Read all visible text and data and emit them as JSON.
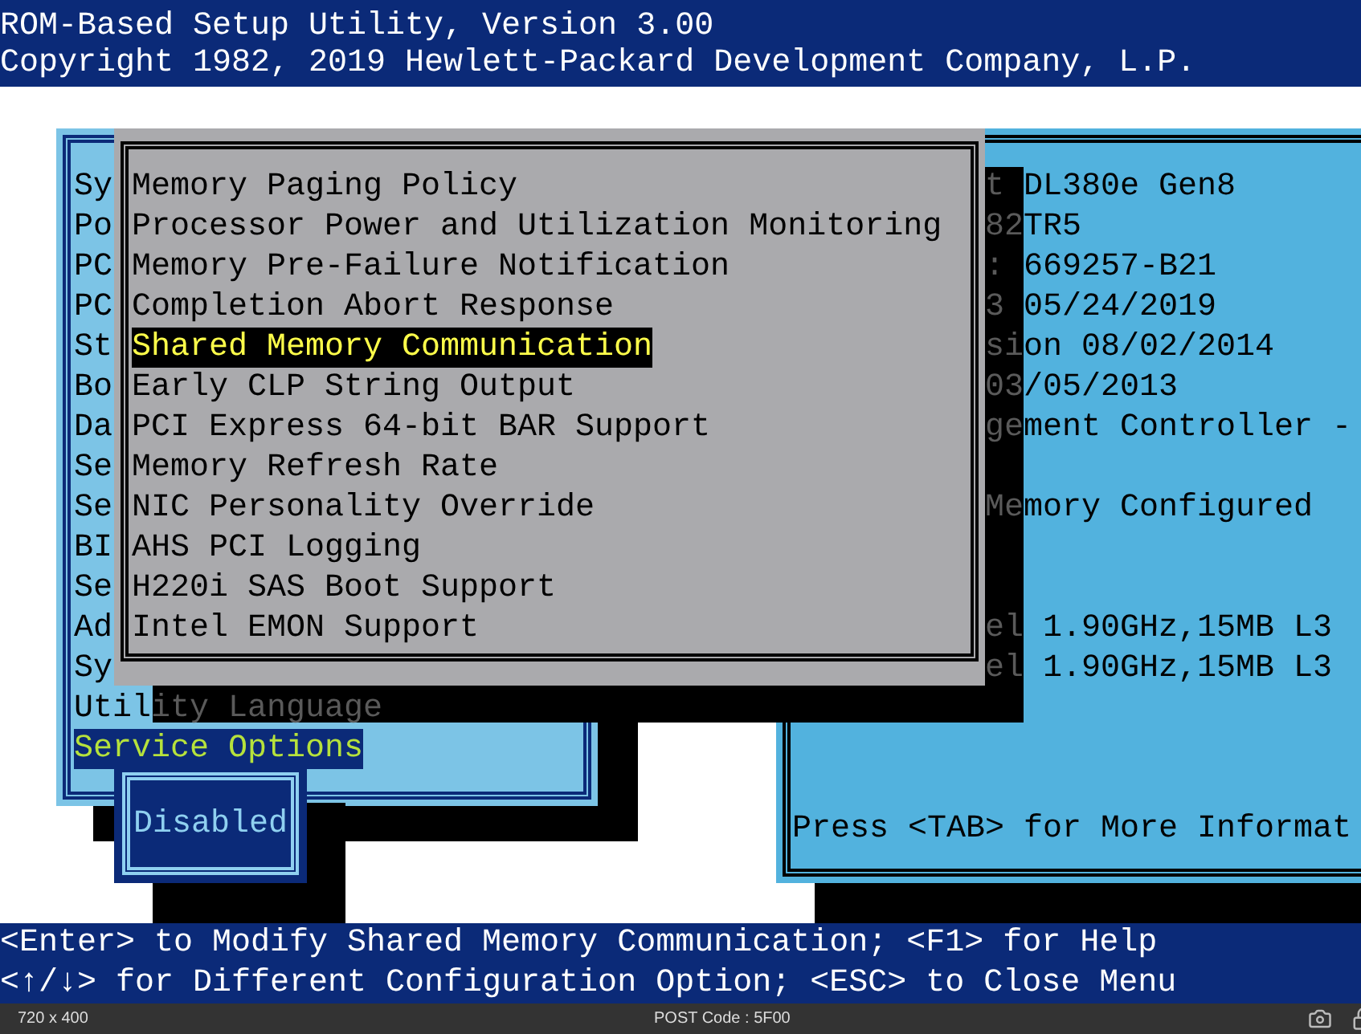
{
  "header": {
    "title": "ROM-Based Setup Utility, Version 3.00",
    "copyright": "Copyright 1982, 2019 Hewlett-Packard Development Company, L.P."
  },
  "main_menu": {
    "items": [
      {
        "label": "Sy",
        "selected": false
      },
      {
        "label": "Po",
        "selected": false
      },
      {
        "label": "PC",
        "selected": false
      },
      {
        "label": "PC",
        "selected": false
      },
      {
        "label": "St",
        "selected": false
      },
      {
        "label": "Bo",
        "selected": false
      },
      {
        "label": "Da",
        "selected": false
      },
      {
        "label": "Se",
        "selected": false
      },
      {
        "label": "Se",
        "selected": false
      },
      {
        "label": "BI",
        "selected": false
      },
      {
        "label": "Se",
        "selected": false
      },
      {
        "label": "Ad",
        "selected": false
      },
      {
        "label": "Sy",
        "selected": false
      },
      {
        "label": "Utility Language",
        "selected": false,
        "shaded": true
      },
      {
        "label": "Service Options",
        "selected": true
      }
    ]
  },
  "info_panel": {
    "lines": [
      {
        "kind": "text",
        "text": "t DL380e Gen8",
        "shaded": true
      },
      {
        "kind": "text",
        "text": "82TR5",
        "shaded": true
      },
      {
        "kind": "text",
        "text": ": 669257-B21",
        "shaded": true
      },
      {
        "kind": "text",
        "text": "3 05/24/2019",
        "shaded": true
      },
      {
        "kind": "text",
        "text": "sion 08/02/2014",
        "shaded": true
      },
      {
        "kind": "text",
        "text": "03/05/2013",
        "shaded": true
      },
      {
        "kind": "text",
        "text": "gement Controller -",
        "shaded": true
      },
      {
        "kind": "blank"
      },
      {
        "kind": "text",
        "text": "Memory Configured",
        "shaded": true
      },
      {
        "kind": "blank"
      },
      {
        "kind": "blank"
      },
      {
        "kind": "text",
        "text": "el 1.90GHz,15MB L3",
        "shaded": true
      },
      {
        "kind": "text",
        "text": "el 1.90GHz,15MB L3",
        "shaded": true
      }
    ],
    "hint": "Press <TAB> for More Informat"
  },
  "popup": {
    "items": [
      {
        "label": "Memory Paging Policy",
        "selected": false
      },
      {
        "label": "Processor Power and Utilization Monitoring",
        "selected": false
      },
      {
        "label": "Memory Pre-Failure Notification",
        "selected": false
      },
      {
        "label": "Completion Abort Response",
        "selected": false
      },
      {
        "label": "Shared Memory Communication",
        "selected": true
      },
      {
        "label": "Early CLP String Output",
        "selected": false
      },
      {
        "label": "PCI Express 64-bit BAR Support",
        "selected": false
      },
      {
        "label": "Memory Refresh Rate",
        "selected": false
      },
      {
        "label": "NIC Personality Override",
        "selected": false
      },
      {
        "label": "AHS PCI Logging",
        "selected": false
      },
      {
        "label": "H220i SAS Boot Support",
        "selected": false
      },
      {
        "label": "Intel EMON Support",
        "selected": false
      }
    ]
  },
  "value_dialog": {
    "value": "Disabled"
  },
  "help_bar": {
    "lines": [
      "<Enter> to Modify Shared Memory Communication; <F1> for Help",
      "<↑/↓> for Different Configuration Option; <ESC> to Close Menu"
    ]
  },
  "status_bar": {
    "resolution": "720 x 400",
    "post_code": "POST Code : 5F00"
  }
}
